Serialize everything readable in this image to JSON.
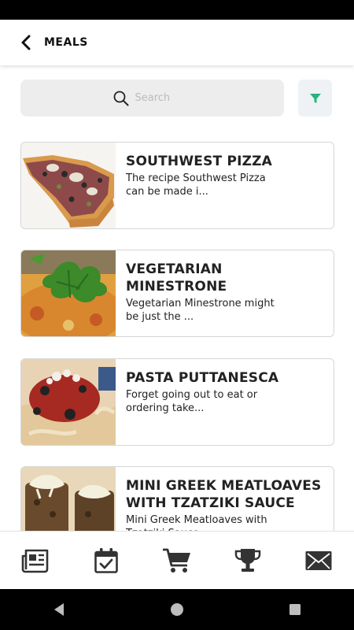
{
  "header": {
    "title": "MEALS"
  },
  "search": {
    "placeholder": "Search"
  },
  "colors": {
    "accent": "#26b37d",
    "icon_dark": "#333333",
    "card_border": "#d6d6d6"
  },
  "meals": [
    {
      "title": "SOUTHWEST PIZZA",
      "description": "The recipe Southwest Pizza can be made i..."
    },
    {
      "title": "VEGETARIAN MINESTRONE",
      "description": "Vegetarian Minestrone might be just the ..."
    },
    {
      "title": "PASTA PUTTANESCA",
      "description": "Forget going out to eat or ordering take..."
    },
    {
      "title": "MINI GREEK MEATLOAVES WITH TZATZIKI SAUCE",
      "description": "Mini Greek Meatloaves with Tzatziki Sauce..."
    }
  ],
  "bottom_nav": [
    {
      "icon": "newspaper-icon"
    },
    {
      "icon": "calendar-check-icon"
    },
    {
      "icon": "shopping-cart-icon"
    },
    {
      "icon": "trophy-icon"
    },
    {
      "icon": "envelope-icon"
    }
  ],
  "system_nav": [
    "back-triangle-icon",
    "home-circle-icon",
    "recents-square-icon"
  ]
}
